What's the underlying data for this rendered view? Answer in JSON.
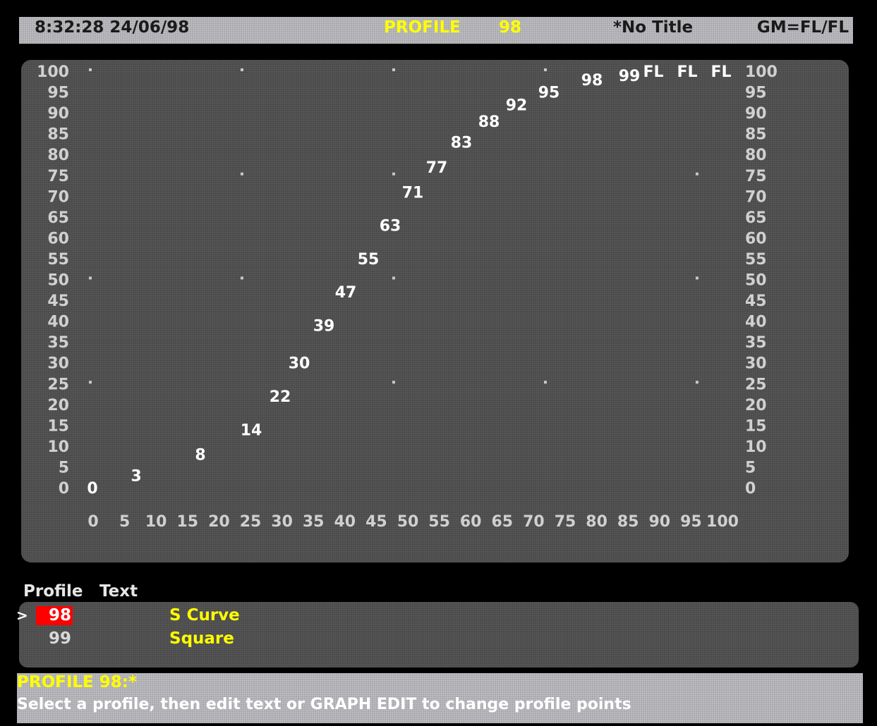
{
  "header": {
    "clock": "8:32:28  24/06/98",
    "title": "PROFILE",
    "profile_number": "98",
    "no_title": "*No Title",
    "gm": "GM=FL/FL"
  },
  "graph": {
    "y_ticks": [
      "100",
      "95",
      "90",
      "85",
      "80",
      "75",
      "70",
      "65",
      "60",
      "55",
      "50",
      "45",
      "40",
      "35",
      "30",
      "25",
      "20",
      "15",
      "10",
      "5",
      "0"
    ],
    "x_ticks": [
      "0",
      "5",
      "10",
      "15",
      "20",
      "25",
      "30",
      "35",
      "40",
      "45",
      "50",
      "55",
      "60",
      "65",
      "70",
      "75",
      "80",
      "85",
      "90",
      "95",
      "100"
    ],
    "fl_labels": [
      "FL",
      "FL",
      "FL"
    ],
    "text_color": "#ffffff",
    "marker_color": "#c8c8c8"
  },
  "chart_data": {
    "type": "scatter",
    "title": "",
    "xlabel": "",
    "ylabel": "",
    "xlim": [
      0,
      100
    ],
    "ylim": [
      0,
      100
    ],
    "points": [
      {
        "x": 0,
        "y": 0,
        "label": "0"
      },
      {
        "x": 5,
        "y": 3,
        "label": "3"
      },
      {
        "x": 10,
        "y": 8,
        "label": "8"
      },
      {
        "x": 15,
        "y": 14,
        "label": "14"
      },
      {
        "x": 20,
        "y": 22,
        "label": "22"
      },
      {
        "x": 25,
        "y": 30,
        "label": "30"
      },
      {
        "x": 30,
        "y": 39,
        "label": "39"
      },
      {
        "x": 35,
        "y": 47,
        "label": "47"
      },
      {
        "x": 40,
        "y": 55,
        "label": "55"
      },
      {
        "x": 45,
        "y": 63,
        "label": "63"
      },
      {
        "x": 50,
        "y": 71,
        "label": "71"
      },
      {
        "x": 55,
        "y": 77,
        "label": "77"
      },
      {
        "x": 60,
        "y": 83,
        "label": "83"
      },
      {
        "x": 65,
        "y": 88,
        "label": "88"
      },
      {
        "x": 70,
        "y": 92,
        "label": "92"
      },
      {
        "x": 75,
        "y": 95,
        "label": "95"
      },
      {
        "x": 80,
        "y": 98,
        "label": "98"
      },
      {
        "x": 85,
        "y": 99,
        "label": "99"
      }
    ],
    "grid_markers": [
      {
        "x": 0,
        "y": 100
      },
      {
        "x": 25,
        "y": 100
      },
      {
        "x": 50,
        "y": 100
      },
      {
        "x": 75,
        "y": 100
      },
      {
        "x": 25,
        "y": 75
      },
      {
        "x": 50,
        "y": 75
      },
      {
        "x": 100,
        "y": 75
      },
      {
        "x": 0,
        "y": 50
      },
      {
        "x": 25,
        "y": 50
      },
      {
        "x": 50,
        "y": 50
      },
      {
        "x": 100,
        "y": 50
      },
      {
        "x": 0,
        "y": 25
      },
      {
        "x": 50,
        "y": 25
      },
      {
        "x": 75,
        "y": 25
      },
      {
        "x": 100,
        "y": 25
      }
    ]
  },
  "profile_list": {
    "column_profile": "Profile",
    "column_text": "Text",
    "cursor": ">",
    "rows": [
      {
        "number": "98",
        "text": "S Curve",
        "selected": true
      },
      {
        "number": "99",
        "text": "Square",
        "selected": false
      }
    ]
  },
  "status": {
    "line1": "PROFILE 98:*",
    "line2": "Select a profile, then edit text or GRAPH EDIT to change profile points"
  }
}
